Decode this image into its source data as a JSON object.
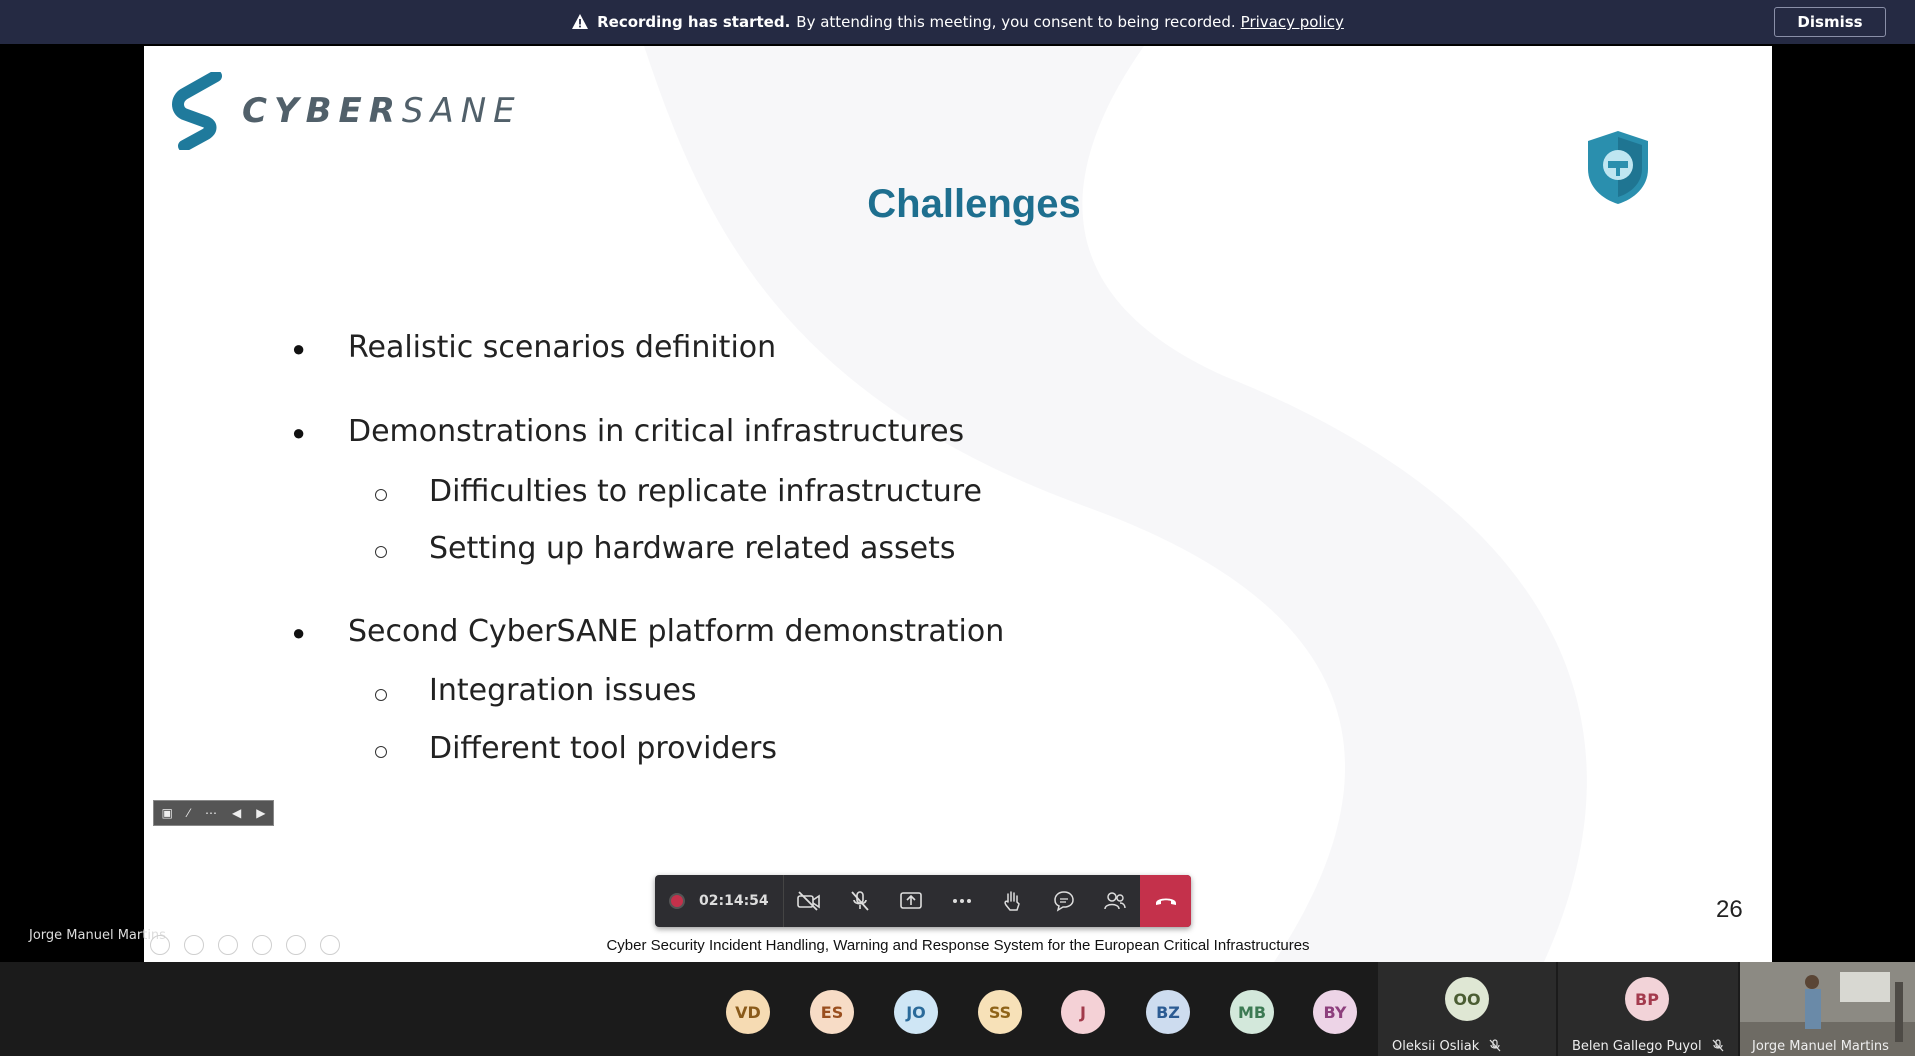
{
  "banner": {
    "title": "Recording has started.",
    "message": "By attending this meeting, you consent to being recorded.",
    "link": "Privacy policy",
    "dismiss_label": "Dismiss"
  },
  "slide": {
    "logo_bold": "CYBER",
    "logo_light": "SANE",
    "title": "Challenges",
    "bullets": [
      {
        "text": "Realistic scenarios definition",
        "sub": []
      },
      {
        "text": "Demonstrations in critical infrastructures",
        "sub": [
          "Difficulties to replicate infrastructure",
          "Setting up hardware related assets"
        ]
      },
      {
        "text": "Second CyberSANE platform demonstration",
        "sub": [
          "Integration issues",
          "Different tool providers"
        ]
      }
    ],
    "page_number": "26",
    "footer": "Cyber Security Incident Handling, Warning and Response System for the European Critical Infrastructures"
  },
  "presenter": {
    "name": "Jorge Manuel Martins"
  },
  "callbar": {
    "timer": "02:14:54"
  },
  "participants": [
    {
      "initials": "VD",
      "bg": "#f6dbb3",
      "fg": "#8a5a1a"
    },
    {
      "initials": "ES",
      "bg": "#f7dcc6",
      "fg": "#9a4f1f"
    },
    {
      "initials": "JO",
      "bg": "#cfe6f5",
      "fg": "#2a6a9a"
    },
    {
      "initials": "SS",
      "bg": "#f7e1b8",
      "fg": "#8f6318"
    },
    {
      "initials": "J",
      "bg": "#f4d1d6",
      "fg": "#a13a4a"
    },
    {
      "initials": "BZ",
      "bg": "#cddcef",
      "fg": "#2b5b93"
    },
    {
      "initials": "MB",
      "bg": "#d3e8db",
      "fg": "#3c7a53"
    },
    {
      "initials": "BY",
      "bg": "#edd4e7",
      "fg": "#8d3f7d"
    }
  ],
  "tiles": [
    {
      "initials": "OO",
      "name": "Oleksii Osliak",
      "bg": "#dfe7d4",
      "fg": "#4b5d33"
    },
    {
      "initials": "BP",
      "name": "Belen Gallego Puyol",
      "bg": "#f2d3d8",
      "fg": "#a33a4d"
    }
  ],
  "video_name": "Jorge Manuel Martins",
  "colors": {
    "banner": "#252a43",
    "accent_title": "#1e6f8f",
    "hangup": "#c4314b"
  }
}
